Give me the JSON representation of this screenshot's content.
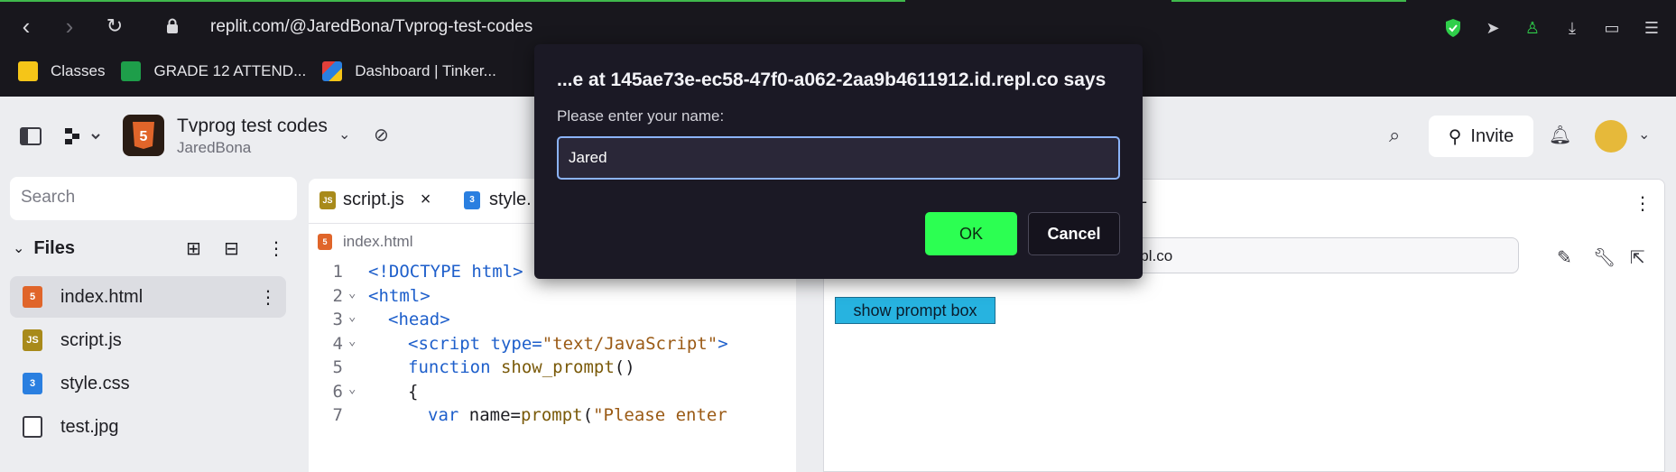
{
  "browser": {
    "url": "replit.com/@JaredBona/Tvprog-test-codes",
    "bookmarks": [
      {
        "label": "Classes",
        "color": "#f5c518"
      },
      {
        "label": "GRADE 12 ATTEND...",
        "color": "#1e9e4a"
      },
      {
        "label": "Dashboard | Tinker...",
        "color": "#e2403a"
      }
    ]
  },
  "repl": {
    "name": "Tvprog test codes",
    "owner": "JaredBona",
    "invite_label": "Invite"
  },
  "sidebar": {
    "search_placeholder": "Search",
    "files_label": "Files",
    "files": [
      {
        "name": "index.html",
        "icon": "html5-icon",
        "color": "#e0652a",
        "glyph": "5",
        "active": true
      },
      {
        "name": "script.js",
        "icon": "js-icon",
        "color": "#a88a1a",
        "glyph": "JS",
        "active": false
      },
      {
        "name": "style.css",
        "icon": "css3-icon",
        "color": "#2a7fe0",
        "glyph": "3",
        "active": false
      },
      {
        "name": "test.jpg",
        "icon": "image-icon",
        "color": "#ffffff",
        "glyph": "",
        "active": false
      }
    ]
  },
  "editor": {
    "tabs": [
      {
        "label": "script.js",
        "close": "×"
      },
      {
        "label": "style."
      }
    ],
    "breadcrumb": "index.html",
    "lines": [
      {
        "n": "1",
        "fold": "",
        "indent": 0,
        "parts": [
          [
            "tag",
            "<!DOCTYPE html>"
          ]
        ]
      },
      {
        "n": "2",
        "fold": "⌄",
        "indent": 0,
        "parts": [
          [
            "tag",
            "<html>"
          ]
        ]
      },
      {
        "n": "3",
        "fold": "⌄",
        "indent": 1,
        "parts": [
          [
            "tag",
            "<head>"
          ]
        ]
      },
      {
        "n": "4",
        "fold": "⌄",
        "indent": 2,
        "parts": [
          [
            "tag",
            "<script "
          ],
          [
            "attr",
            "type="
          ],
          [
            "str",
            "\"text/JavaScript\""
          ],
          [
            "tag",
            ">"
          ]
        ]
      },
      {
        "n": "5",
        "fold": "",
        "indent": 2,
        "parts": [
          [
            "kw",
            "function "
          ],
          [
            "fn",
            "show_prompt"
          ],
          [
            "plain",
            "()"
          ]
        ]
      },
      {
        "n": "6",
        "fold": "⌄",
        "indent": 2,
        "parts": [
          [
            "plain",
            "{"
          ]
        ]
      },
      {
        "n": "7",
        "fold": "",
        "indent": 3,
        "parts": [
          [
            "kw",
            "var "
          ],
          [
            "plain",
            "name="
          ],
          [
            "fn",
            "prompt"
          ],
          [
            "plain",
            "("
          ],
          [
            "str",
            "\"Please enter"
          ]
        ]
      }
    ]
  },
  "preview": {
    "url_fragment": "a.repl.co",
    "button_label": "show prompt box",
    "dash": "-"
  },
  "dialog": {
    "title": "...e at 145ae73e-ec58-47f0-a062-2aa9b4611912.id.repl.co says",
    "message": "Please enter your name:",
    "input_value": "Jared",
    "ok_label": "OK",
    "cancel_label": "Cancel"
  },
  "colors": {
    "ok_green": "#2cff52",
    "preview_button": "#27b3e0"
  }
}
